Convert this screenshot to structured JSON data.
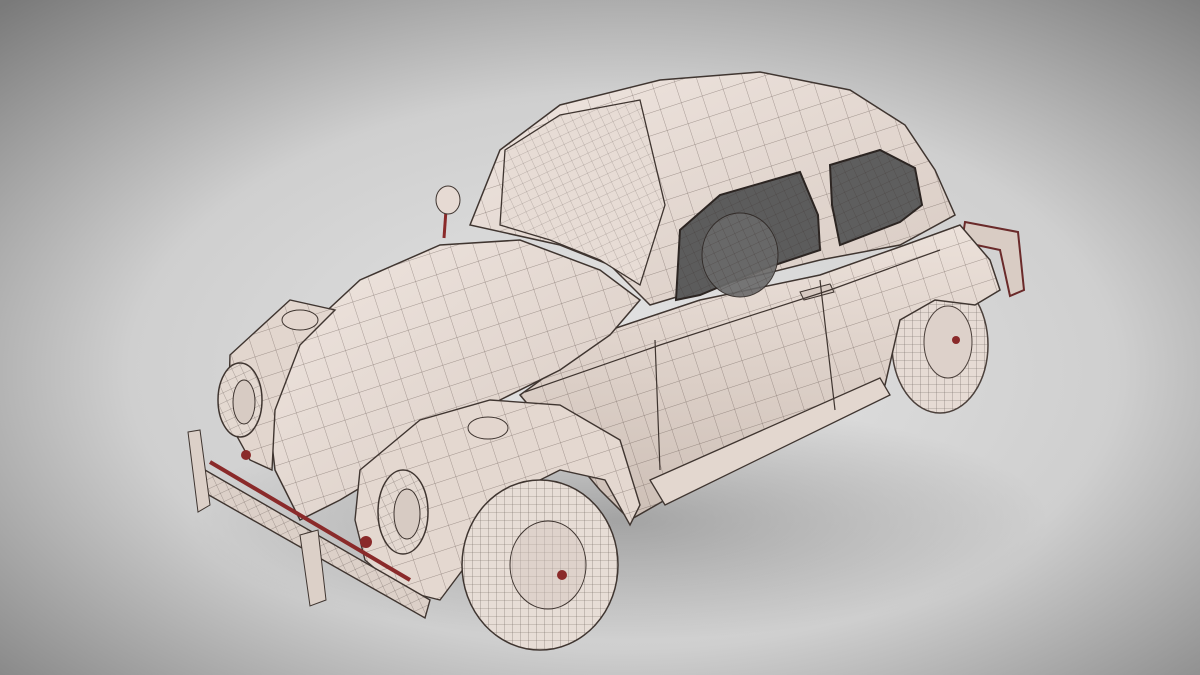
{
  "scene": {
    "subject": "car-wireframe-render",
    "colors": {
      "backdrop_center": "#dedede",
      "backdrop_edge": "#7c7c7c",
      "body": "#e9ddd6",
      "body_shade": "#cfc2ba",
      "wire": "#4a3f3a",
      "glass": "#5a5a5a",
      "chrome_red": "#8a2a2a"
    }
  }
}
